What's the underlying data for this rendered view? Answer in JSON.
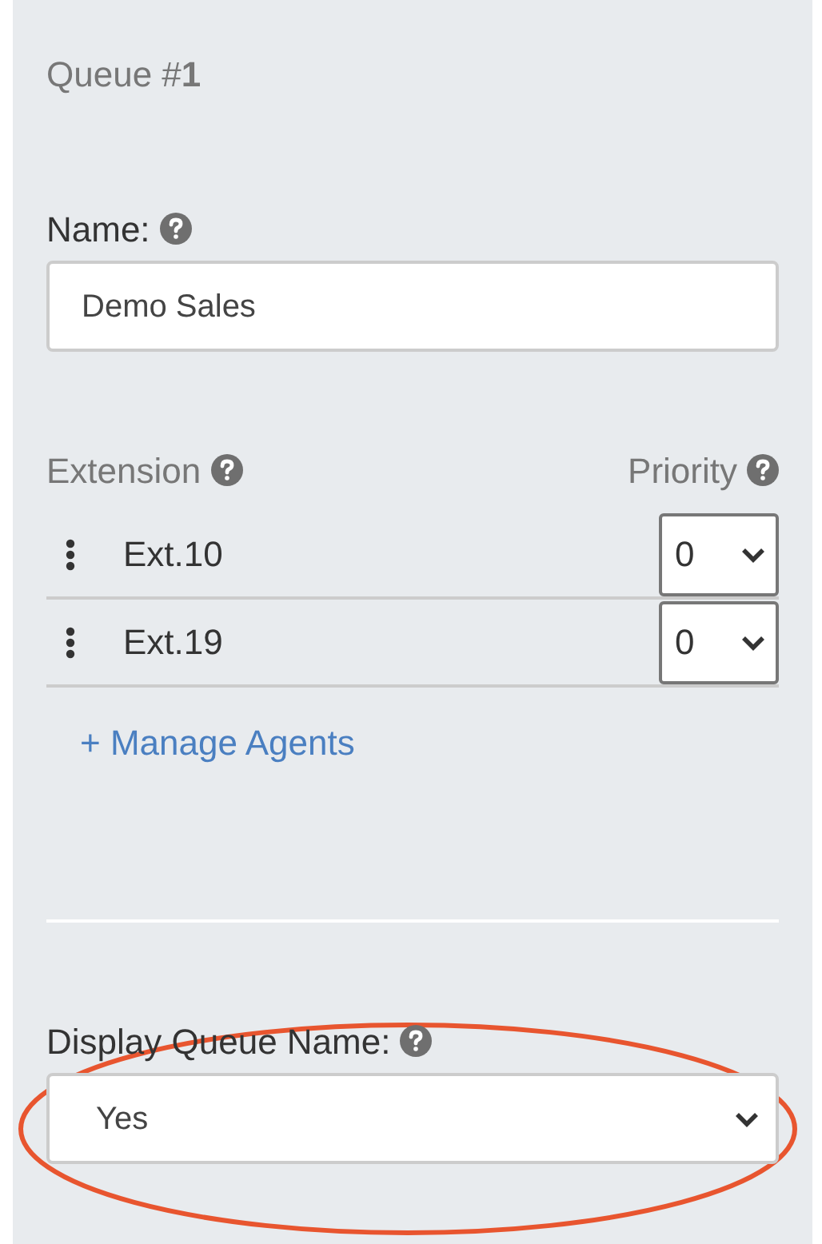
{
  "queue_title": "Queue #**1**",
  "name_field": {
    "label": "Name:",
    "value": "Demo Sales"
  },
  "agents": {
    "columns": [
      "Extension",
      "Priority"
    ],
    "rows": [
      {
        "extension": "Ext.10",
        "priority": "0"
      },
      {
        "extension": "Ext.19",
        "priority": "0"
      }
    ],
    "manage_link": "+ Manage Agents"
  },
  "display_queue_name": {
    "label": "Display Queue Name:",
    "value": "Yes",
    "highlighted": true
  }
}
